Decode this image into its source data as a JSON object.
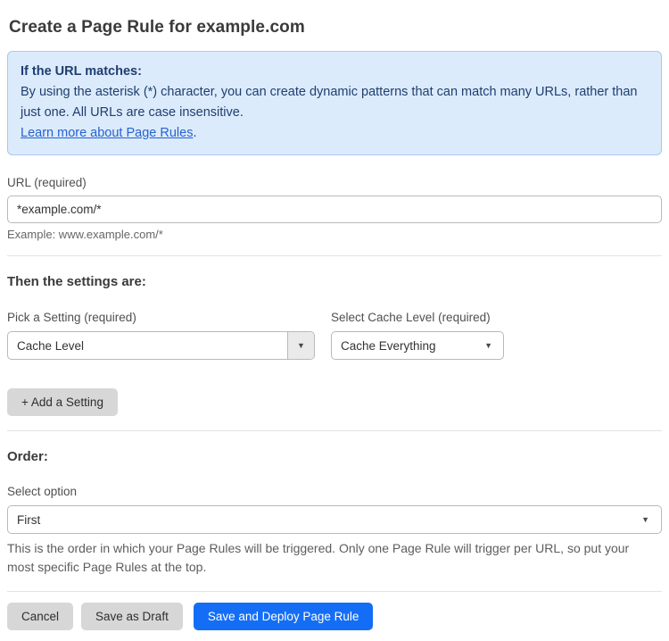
{
  "page": {
    "title": "Create a Page Rule for example.com"
  },
  "info_box": {
    "heading": "If the URL matches:",
    "body": "By using the asterisk (*) character, you can create dynamic patterns that can match many URLs, rather than just one. All URLs are case insensitive.",
    "link_text": "Learn more about Page Rules",
    "link_suffix": "."
  },
  "url_field": {
    "label": "URL (required)",
    "value": "*example.com/*",
    "helper": "Example: www.example.com/*"
  },
  "settings": {
    "heading": "Then the settings are:",
    "setting_picker": {
      "label": "Pick a Setting (required)",
      "selected": "Cache Level"
    },
    "cache_level_picker": {
      "label": "Select Cache Level (required)",
      "selected": "Cache Everything"
    },
    "add_button_label": "+ Add a Setting"
  },
  "order": {
    "heading": "Order:",
    "label": "Select option",
    "selected": "First",
    "helper": "This is the order in which your Page Rules will be triggered. Only one Page Rule will trigger per URL, so put your most specific Page Rules at the top."
  },
  "footer": {
    "cancel_label": "Cancel",
    "save_draft_label": "Save as Draft",
    "save_deploy_label": "Save and Deploy Page Rule"
  },
  "icons": {
    "dropdown_arrow": "▼"
  },
  "colors": {
    "info_bg": "#dcebfb",
    "info_border": "#a9c8ee",
    "info_text": "#1f3e70",
    "link": "#2563cf",
    "primary_button": "#146ef5"
  }
}
